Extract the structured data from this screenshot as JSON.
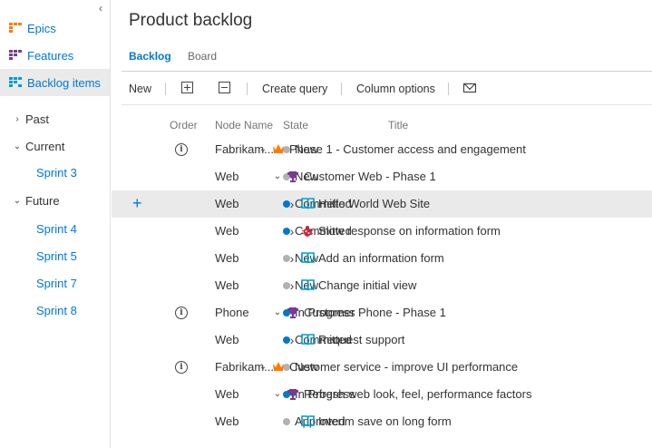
{
  "sidebar": {
    "collapse_icon": "chevron-left-icon",
    "nav": [
      {
        "label": "Epics",
        "icon": "epics-icon"
      },
      {
        "label": "Features",
        "icon": "features-icon"
      },
      {
        "label": "Backlog items",
        "icon": "backlog-items-icon"
      }
    ],
    "tree": [
      {
        "label": "Past",
        "expanded": false
      },
      {
        "label": "Current",
        "expanded": true
      },
      {
        "label": "Future",
        "expanded": true
      }
    ],
    "sprints": {
      "current": [
        "Sprint 3"
      ],
      "future": [
        "Sprint 4",
        "Sprint 5",
        "Sprint 7",
        "Sprint 8"
      ]
    }
  },
  "header": {
    "title": "Product backlog",
    "tabs": [
      {
        "label": "Backlog",
        "active": true
      },
      {
        "label": "Board",
        "active": false
      }
    ]
  },
  "toolbar": {
    "new_label": "New",
    "expand_icon": "expand-all-icon",
    "collapse_icon": "collapse-all-icon",
    "create_query_label": "Create query",
    "column_options_label": "Column options",
    "email_icon": "mail-icon"
  },
  "grid": {
    "columns": {
      "order": "Order",
      "node_name": "Node Name",
      "state": "State",
      "title": "Title"
    },
    "rows": [
      {
        "info": true,
        "node": "Fabrikam...",
        "state": "New",
        "state_color": "#b2b2b2",
        "level": 0,
        "expander": "down",
        "type": "epic",
        "title": "Phase 1 - Customer access and engagement"
      },
      {
        "info": false,
        "node": "Web",
        "state": "New",
        "state_color": "#b2b2b2",
        "level": 1,
        "expander": "down",
        "type": "feature",
        "title": "Customer Web - Phase 1"
      },
      {
        "info": false,
        "node": "Web",
        "state": "Committed",
        "state_color": "#007acc",
        "level": 2,
        "expander": "right",
        "type": "pbi",
        "title": "Hello World Web Site",
        "highlight": true
      },
      {
        "info": false,
        "node": "Web",
        "state": "Committed",
        "state_color": "#007acc",
        "level": 2,
        "expander": "right",
        "type": "bug",
        "title": "Slow response on information form"
      },
      {
        "info": false,
        "node": "Web",
        "state": "New",
        "state_color": "#b2b2b2",
        "level": 2,
        "expander": "right",
        "type": "pbi",
        "title": "Add an information form"
      },
      {
        "info": false,
        "node": "Web",
        "state": "New",
        "state_color": "#b2b2b2",
        "level": 2,
        "expander": "right",
        "type": "pbi",
        "title": "Change initial view"
      },
      {
        "info": true,
        "node": "Phone",
        "state": "In Progress",
        "state_color": "#007acc",
        "level": 1,
        "expander": "down",
        "type": "feature",
        "title": "Customer Phone - Phase 1"
      },
      {
        "info": false,
        "node": "Web",
        "state": "Committed",
        "state_color": "#007acc",
        "level": 2,
        "expander": "right",
        "type": "pbi",
        "title": "Request support"
      },
      {
        "info": true,
        "node": "Fabrikam...",
        "state": "New",
        "state_color": "#b2b2b2",
        "level": 0,
        "expander": "down",
        "type": "epic",
        "title": "Customer service - improve UI performance"
      },
      {
        "info": false,
        "node": "Web",
        "state": "In Progress",
        "state_color": "#007acc",
        "level": 1,
        "expander": "down",
        "type": "feature",
        "title": "Refresh web look, feel, performance factors"
      },
      {
        "info": false,
        "node": "Web",
        "state": "Approved",
        "state_color": "#b2b2b2",
        "level": 2,
        "expander": "none",
        "type": "pbi",
        "title": "Interim save on long form"
      }
    ]
  },
  "colors": {
    "accent": "#0078d4",
    "epic": "#ff7b00",
    "feature": "#773b93",
    "pbi": "#009ccc",
    "bug": "#cc293d",
    "committed": "#007acc",
    "new": "#b2b2b2"
  }
}
